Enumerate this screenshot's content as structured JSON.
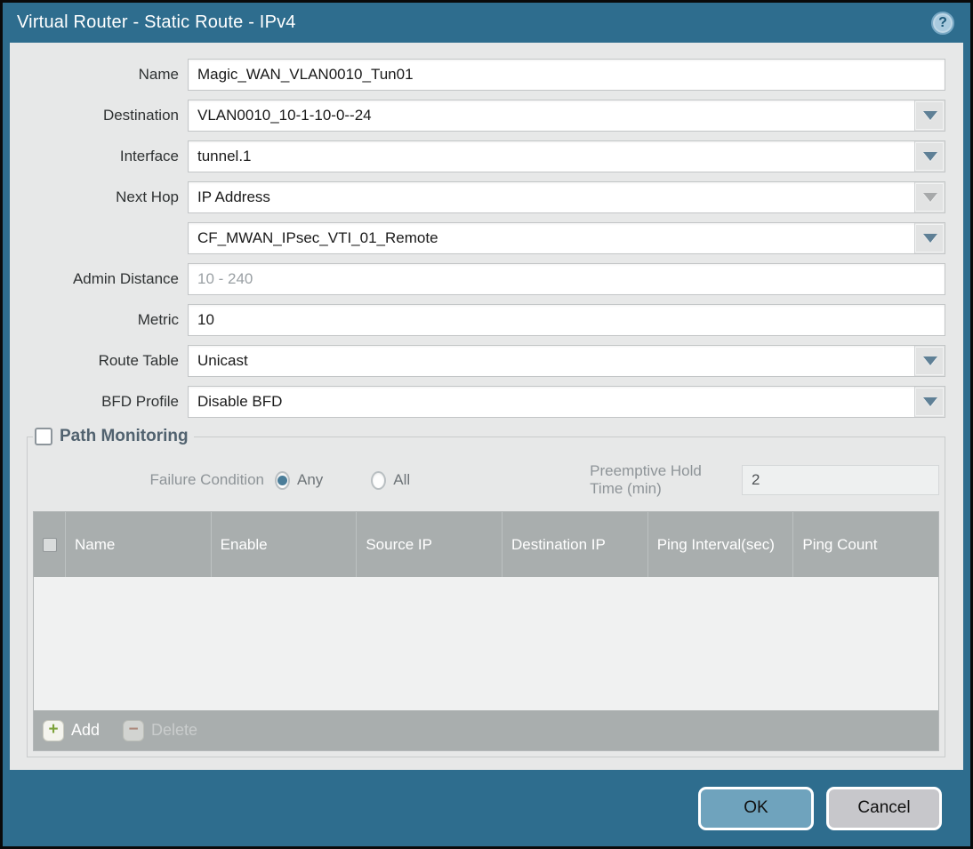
{
  "window": {
    "title": "Virtual Router - Static Route - IPv4",
    "help_glyph": "?"
  },
  "form": {
    "name": {
      "label": "Name",
      "value": "Magic_WAN_VLAN0010_Tun01"
    },
    "destination": {
      "label": "Destination",
      "value": "VLAN0010_10-1-10-0--24"
    },
    "interface": {
      "label": "Interface",
      "value": "tunnel.1"
    },
    "next_hop": {
      "label": "Next Hop",
      "value": "IP Address"
    },
    "next_hop_address": {
      "value": "CF_MWAN_IPsec_VTI_01_Remote"
    },
    "admin_distance": {
      "label": "Admin Distance",
      "placeholder": "10 - 240",
      "value": ""
    },
    "metric": {
      "label": "Metric",
      "value": "10"
    },
    "route_table": {
      "label": "Route Table",
      "value": "Unicast"
    },
    "bfd_profile": {
      "label": "BFD Profile",
      "value": "Disable BFD"
    }
  },
  "path_monitoring": {
    "title": "Path Monitoring",
    "checked": false,
    "failure_condition": {
      "label": "Failure Condition",
      "options": [
        "Any",
        "All"
      ],
      "selected": "Any"
    },
    "preemptive_hold_time": {
      "label": "Preemptive Hold Time (min)",
      "value": "2"
    },
    "table": {
      "columns": [
        "Name",
        "Enable",
        "Source IP",
        "Destination IP",
        "Ping Interval(sec)",
        "Ping Count"
      ],
      "rows": []
    },
    "actions": {
      "add": "Add",
      "add_glyph": "+",
      "delete": "Delete",
      "delete_glyph": "−"
    }
  },
  "footer": {
    "ok": "OK",
    "cancel": "Cancel"
  },
  "colors": {
    "titlebar": "#2e6d8e",
    "body_bg": "#e7e8e8",
    "table_header": "#a9aeae",
    "ok_button": "#6fa3bd",
    "cancel_button": "#c7c7cb",
    "dropdown_arrow": "#5f8096",
    "legend_text": "#51626f"
  }
}
